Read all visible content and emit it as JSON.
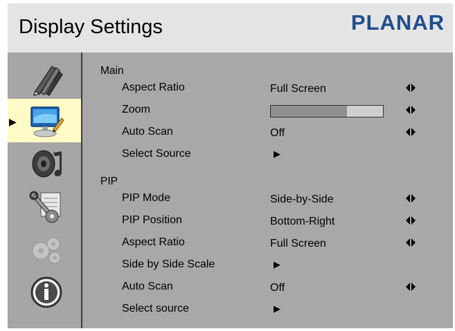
{
  "header": {
    "title": "Display Settings",
    "brand": "PLANAR"
  },
  "sidebar": {
    "items": [
      {
        "name": "pens-icon",
        "selected": false
      },
      {
        "name": "display-icon",
        "selected": true
      },
      {
        "name": "speaker-icon",
        "selected": false
      },
      {
        "name": "tools-icon",
        "selected": false
      },
      {
        "name": "gears-icon",
        "selected": false,
        "disabled": true
      },
      {
        "name": "info-icon",
        "selected": false
      }
    ],
    "selection_marker": "▶"
  },
  "main": {
    "group_main": "Main",
    "aspect_ratio_label": "Aspect Ratio",
    "aspect_ratio_value": "Full Screen",
    "zoom_label": "Zoom",
    "zoom_level": 0.68,
    "auto_scan_label": "Auto Scan",
    "auto_scan_value": "Off",
    "select_source_label": "Select Source",
    "submenu_marker": "▶",
    "group_pip": "PIP",
    "pip_mode_label": "PIP Mode",
    "pip_mode_value": "Side-by-Side",
    "pip_position_label": "PIP Position",
    "pip_position_value": "Bottom-Right",
    "pip_aspect_ratio_label": "Aspect Ratio",
    "pip_aspect_ratio_value": "Full Screen",
    "sbs_scale_label": "Side by Side Scale",
    "pip_auto_scan_label": "Auto Scan",
    "pip_auto_scan_value": "Off",
    "pip_select_source_label": "Select source"
  },
  "colors": {
    "panel": "#a8a8a8",
    "header": "#e4e4e4",
    "brand": "#1f4d8e",
    "selected": "#fffbc7"
  }
}
